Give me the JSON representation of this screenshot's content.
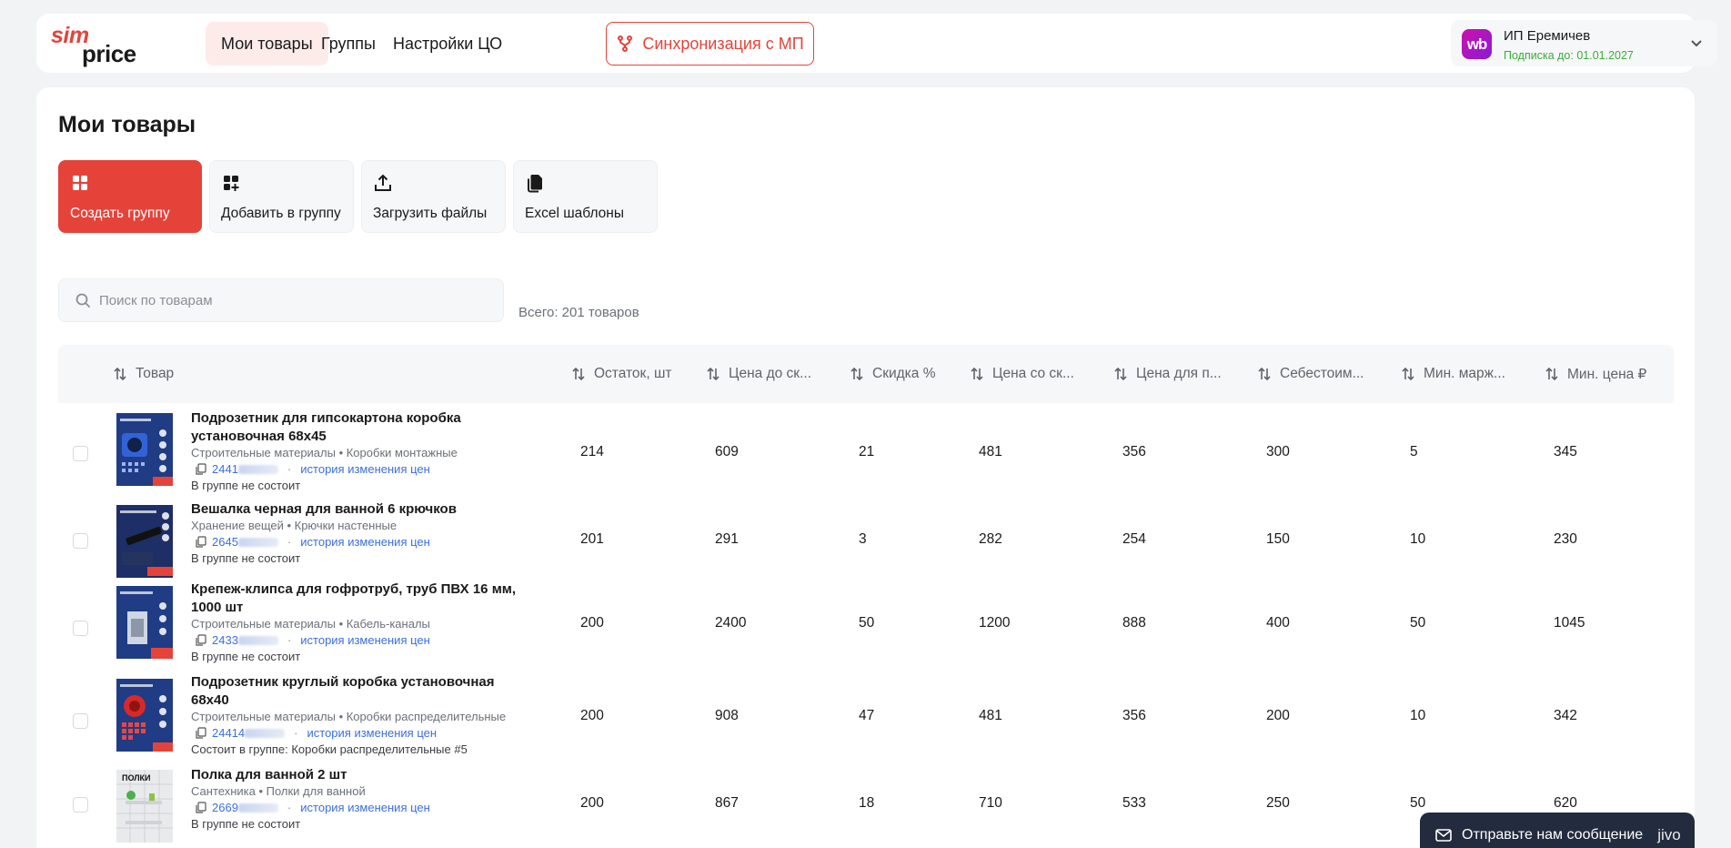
{
  "brand": {
    "logo_top": "sim",
    "logo_bottom": "price",
    "accent": "#e5433a"
  },
  "nav": {
    "items": [
      "Мои товары",
      "Группы",
      "Настройки ЦО"
    ],
    "sync_label": "Синхронизация с МП"
  },
  "account": {
    "badge": "wb",
    "name": "ИП Еремичев",
    "subscription": "Подписка до: 01.01.2027"
  },
  "page": {
    "title": "Мои товары"
  },
  "actions": [
    {
      "label": "Создать группу",
      "icon": "grid-icon"
    },
    {
      "label": "Добавить в группу",
      "icon": "grid-plus-icon"
    },
    {
      "label": "Загрузить файлы",
      "icon": "upload-icon"
    },
    {
      "label": "Excel шаблоны",
      "icon": "files-icon"
    }
  ],
  "search": {
    "placeholder": "Поиск по товарам",
    "value": ""
  },
  "total": "Всего: 201 товаров",
  "table": {
    "columns": [
      "Товар",
      "Остаток, шт",
      "Цена до ск...",
      "Скидка %",
      "Цена со ск...",
      "Цена для п...",
      "Себестоим...",
      "Мин. марж...",
      "Мин. цена ₽"
    ],
    "history_label": "история изменения цен",
    "rows": [
      {
        "name": "Подрозетник для гипсокартона коробка установочная 68х45",
        "category": "Строительные материалы • Коробки монтажные",
        "id": "2441",
        "group": "В группе не состоит",
        "values": [
          "214",
          "609",
          "21",
          "481",
          "356",
          "300",
          "5",
          "345"
        ]
      },
      {
        "name": "Вешалка черная для ванной 6 крючков",
        "category": "Хранение вещей • Крючки настенные",
        "id": "2645",
        "group": "В группе не состоит",
        "values": [
          "201",
          "291",
          "3",
          "282",
          "254",
          "150",
          "10",
          "230"
        ]
      },
      {
        "name": "Крепеж-клипса для гофротруб, труб ПВХ 16 мм, 1000 шт",
        "category": "Строительные материалы • Кабель-каналы",
        "id": "2433",
        "group": "В группе не состоит",
        "values": [
          "200",
          "2400",
          "50",
          "1200",
          "888",
          "400",
          "50",
          "1045"
        ]
      },
      {
        "name": "Подрозетник круглый коробка установочная 68х40",
        "category": "Строительные материалы • Коробки распределительные",
        "id": "24414",
        "group": "Состоит в группе: Коробки распределительные #5",
        "values": [
          "200",
          "908",
          "47",
          "481",
          "356",
          "200",
          "10",
          "342"
        ]
      },
      {
        "name": "Полка для ванной 2 шт",
        "category": "Сантехника • Полки для ванной",
        "id": "2669",
        "group": "В группе не состоит",
        "values": [
          "200",
          "867",
          "18",
          "710",
          "533",
          "250",
          "50",
          "620"
        ]
      }
    ]
  },
  "chat": {
    "label": "Отправьте нам сообщение",
    "brand": "jivo"
  }
}
